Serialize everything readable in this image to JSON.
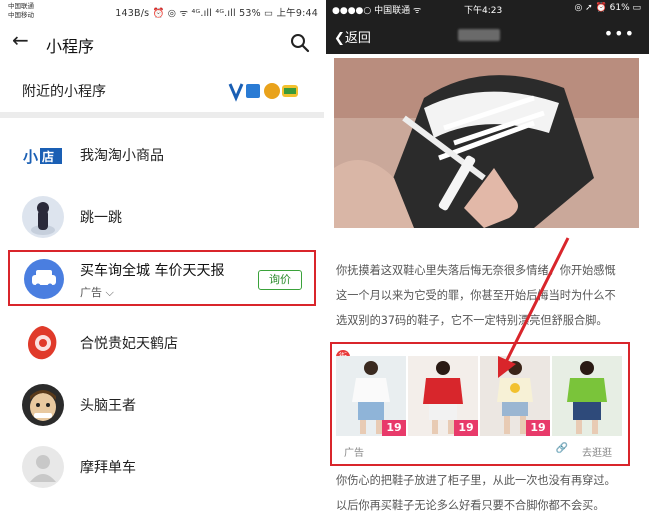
{
  "left": {
    "status": {
      "carrier_1": "中国联通",
      "carrier_2": "中国移动",
      "info": "143B/s ⏰ ◎ ᯤ ⁴ᴳ.ıll ⁴ᴳ.ıll 53% ▭ 上午9:44"
    },
    "header": {
      "title": "小程序"
    },
    "nearby": {
      "label": "附近的小程序"
    },
    "items": [
      {
        "name": "我淘淘小商品",
        "icon_text": "小店"
      },
      {
        "name": "跳一跳"
      },
      {
        "name": "合悦贵妃天鹤店"
      },
      {
        "name": "头脑王者"
      },
      {
        "name": "摩拜单车"
      }
    ],
    "ad": {
      "name": "买车询全城 车价天天报",
      "tag": "广告",
      "button": "询价"
    }
  },
  "right": {
    "status": {
      "carrier": "●●●●○ 中国联通 ᯤ",
      "time": "下午4:23",
      "battery": "◎ ➚ ⏰ 61% ▭"
    },
    "nav": {
      "back": "返回",
      "more": "•••"
    },
    "article": {
      "para1": [
        "你抚摸着这双鞋心里失落后悔无奈很多情绪，你开始感慨",
        "这一个月以来为它受的罪，你甚至开始后悔当时为什么不",
        "选双别的37码的鞋子，它不一定特别漂亮但舒服合脚。"
      ],
      "para2": [
        "你伤心的把鞋子放进了柜子里，从此一次也没有再穿过。",
        "以后你再买鞋子无论多么好看只要不合脚你都不会买。"
      ]
    },
    "goods": {
      "corner": "街",
      "prices": [
        "19",
        "19",
        "19"
      ],
      "ad_tag": "广告",
      "go_label": "去逛逛"
    }
  },
  "colors": {
    "highlight": "#d9252b",
    "wechat_green": "#3aa23a",
    "price_pink": "#e83a6a"
  }
}
